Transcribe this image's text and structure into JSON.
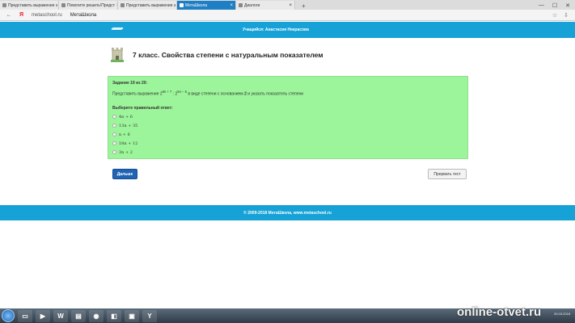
{
  "browser": {
    "tabs": [
      {
        "label": "Представить выражение з",
        "active": false
      },
      {
        "label": "Помогите решить!Предст",
        "active": false
      },
      {
        "label": "Представить выражение з",
        "active": false
      },
      {
        "label": "МетаШкола",
        "active": true
      },
      {
        "label": "Диалоги",
        "active": false
      }
    ],
    "new_tab": "+",
    "url": "metaschool.ru",
    "page_title": "МетаШкола",
    "window_controls": [
      "—",
      "☐",
      "✕"
    ]
  },
  "header": {
    "user": "Учащийся: Анастасия Некрасова"
  },
  "page": {
    "title": "7 класс. Свойства степени с натуральным показателем"
  },
  "question": {
    "number": "Задание 19 из 20:",
    "text_before": "Представить выражение 2",
    "exp1": "8n + 7",
    "colon": " : 2",
    "exp2": "5n − 6",
    "text_after": " в виде степени с основанием ",
    "base": "2",
    "text_end": " и указать показатель степени",
    "prompt": "Выберите правильный ответ:",
    "options": [
      "4n + 6",
      "13n + 35",
      "n + 6",
      "18n + 12",
      "3n + 2"
    ]
  },
  "buttons": {
    "next": "Дальше",
    "stop": "Прервать тест"
  },
  "footer": {
    "text": "© 2009-2018 МетаШкола, www.metaschool.ru"
  },
  "watermark": "online-otvet.ru",
  "tray": {
    "date": "20.03.2018"
  },
  "colors": {
    "header": "#16a2d6",
    "question_bg": "#9cf59a",
    "next_button": "#1f63b5"
  }
}
